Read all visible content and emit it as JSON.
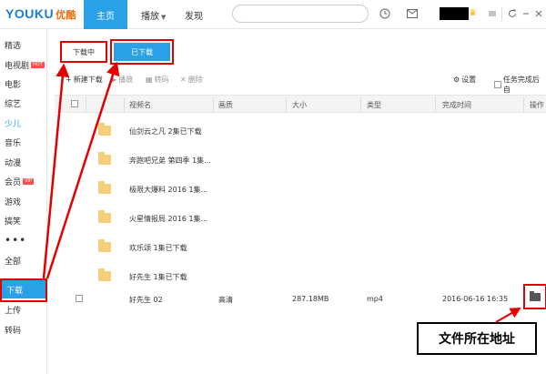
{
  "logo": {
    "brand": "YOUKU",
    "cn": "优酷"
  },
  "topnav": {
    "home": "主页",
    "play": "播放",
    "discover": "发现"
  },
  "sidebar": {
    "items": [
      {
        "label": "精选"
      },
      {
        "label": "电视剧",
        "badge": "HOT"
      },
      {
        "label": "电影"
      },
      {
        "label": "综艺"
      },
      {
        "label": "少儿"
      },
      {
        "label": "音乐"
      },
      {
        "label": "动漫"
      },
      {
        "label": "会员",
        "badge": "VIP"
      },
      {
        "label": "游戏"
      },
      {
        "label": "搞笑"
      },
      {
        "label": "•••"
      },
      {
        "label": "全部"
      },
      {
        "label": "下载"
      },
      {
        "label": "上传"
      },
      {
        "label": "转码"
      }
    ]
  },
  "tabs": {
    "downloading": "下载中",
    "downloaded": "已下载"
  },
  "toolbar": {
    "new_download": "新建下载",
    "play": "播放",
    "transcode": "转码",
    "delete": "删除",
    "settings": "设置",
    "after_done": "任务完成后自"
  },
  "table": {
    "headers": {
      "name": "视频名",
      "quality": "画质",
      "size": "大小",
      "type": "类型",
      "finished": "完成时间",
      "operate": "操作"
    },
    "folders": [
      "仙剑云之凡   2集已下载",
      "奔跑吧兄弟 第四季   1集...",
      "极限大爆料 2016   1集...",
      "火星情报局 2016   1集...",
      "欢乐颂   1集已下载",
      "好先生   1集已下载"
    ],
    "file": {
      "name": "好先生 02",
      "quality": "高清",
      "size": "287.18MB",
      "type": "mp4",
      "finished": "2016-06-16 16:35"
    }
  },
  "annotation": "文件所在地址",
  "colors": {
    "accent": "#2aa1e6",
    "highlight": "#e30000",
    "folder": "#f3cf7c"
  }
}
